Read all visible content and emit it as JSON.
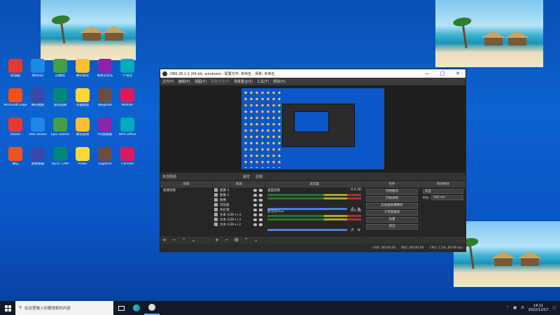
{
  "desktop": {
    "icons": [
      {
        "label": "此电脑"
      },
      {
        "label": "腾讯QQ"
      },
      {
        "label": "回收站"
      },
      {
        "label": "腾讯会议"
      },
      {
        "label": "网易云音乐"
      },
      {
        "label": "YY语音"
      },
      {
        "label": "Microsoft Edge"
      },
      {
        "label": "腾讯视频"
      },
      {
        "label": "暴雪战网"
      },
      {
        "label": "英雄联盟"
      },
      {
        "label": "Wegame"
      },
      {
        "label": "NVIDIA"
      },
      {
        "label": "Steam"
      },
      {
        "label": "OBS Studio"
      },
      {
        "label": "Epic Games"
      },
      {
        "label": "腾讯游戏"
      },
      {
        "label": "UU加速器"
      },
      {
        "label": "WPS Office"
      },
      {
        "label": "微信"
      },
      {
        "label": "网易邮箱"
      },
      {
        "label": "NZXT CAM"
      },
      {
        "label": "PUBG"
      },
      {
        "label": "Logitech"
      },
      {
        "label": "Chrome"
      }
    ]
  },
  "obs": {
    "title": "OBS 26.1.1 (64-bit, windows) - 配置文件: 未命名 - 场景: 未命名",
    "menu": [
      "文件(F)",
      "编辑(E)",
      "视图(V)",
      "配置文件(P)",
      "场景集合(S)",
      "工具(T)",
      "帮助(H)"
    ],
    "midbar": {
      "left": "未选择源",
      "props": "属性",
      "filters": "滤镜"
    },
    "panels": {
      "scenes": "场景",
      "sources": "来源",
      "mixer": "混音器",
      "controls": "控件",
      "transitions": "转场特效"
    },
    "scenes": [
      "新建场景"
    ],
    "sources": [
      "图像 3",
      "图像 2",
      "图像",
      "浏览器",
      "色彩源",
      "文本 (GDI+) 4",
      "文本 (GDI+) 3",
      "文本 (GDI+) 2"
    ],
    "mixer": [
      {
        "name": "桌面音频",
        "db": "-0.0 dB"
      },
      {
        "name": "麦克风/Aux",
        "db": "-0.0 dB"
      }
    ],
    "controls": [
      "开始推流",
      "开始录制",
      "启动虚拟摄像机",
      "工作室模式",
      "设置",
      "退出"
    ],
    "transitions": {
      "type": "淡出",
      "duration_label": "时长",
      "duration": "300 ms"
    },
    "status": {
      "live": "LIVE: 00:00:00",
      "rec": "REC: 00:00:00",
      "cpu": "CPU: 1.5%, 60.00 fps"
    }
  },
  "taskbar": {
    "search_placeholder": "在这里输入你要搜索的内容",
    "time": "14:11",
    "date": "2022/12/17"
  },
  "colors": {
    "accent": "#0c63d0",
    "obs_bg": "#2b2b2b"
  }
}
